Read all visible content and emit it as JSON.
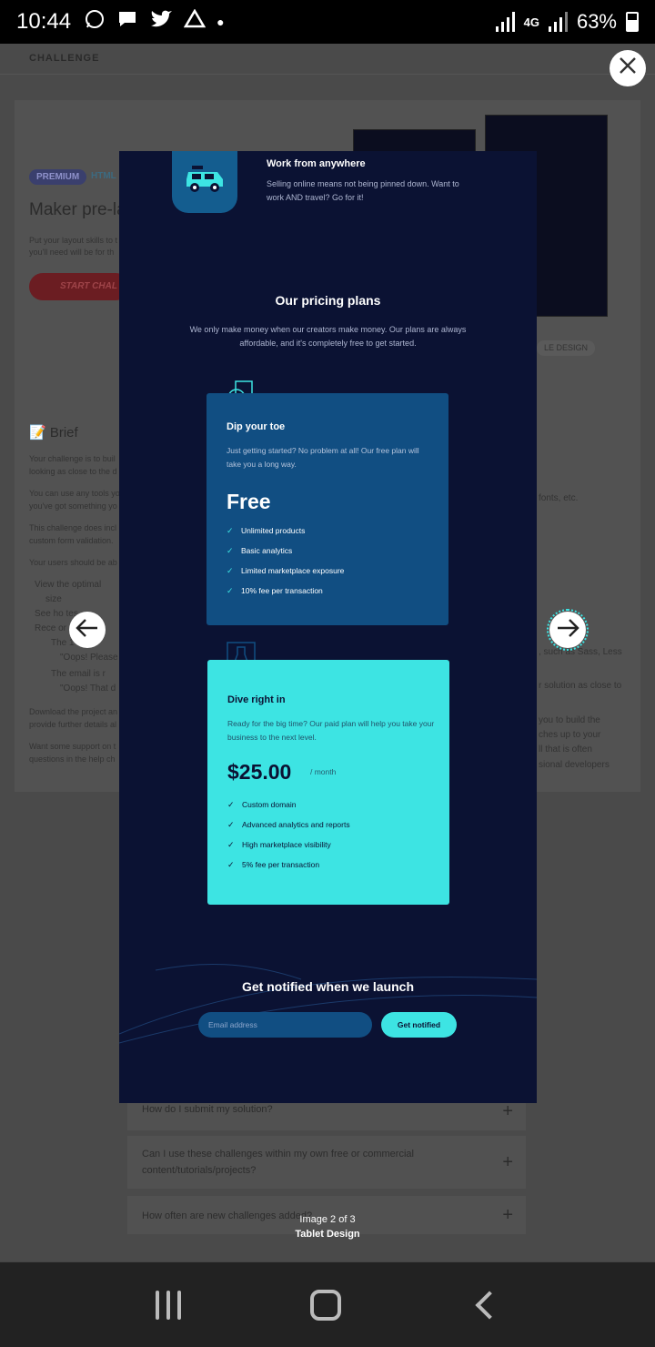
{
  "status_bar": {
    "time": "10:44",
    "network": "4G",
    "battery": "63%",
    "icons": [
      "whatsapp-icon",
      "message-icon",
      "twitter-icon",
      "drive-icon",
      "dot-icon"
    ]
  },
  "background_page": {
    "header": "CHALLENGE",
    "badge_premium": "PREMIUM",
    "badge_html": "HTML",
    "title": "Maker pre-la",
    "intro_line1": "Put your layout skills to t",
    "intro_line2": "you'll need will be for th",
    "start_button": "START CHAL",
    "preview_tag": "LE DESIGN",
    "brief_title": "📝 Brief",
    "brief_lines": [
      "Your challenge is to buil",
      "looking as close to the d",
      "You can use any tools yo",
      "you've got something yo",
      "This challenge does incl",
      "custom form validation.",
      "Your users should be ab"
    ],
    "bullets": [
      "View the optimal",
      "size",
      "See ho    tes",
      "Rece      or"
    ],
    "sub_bullets": [
      "The      1",
      "\"Oops! Please",
      "The email is r",
      "\"Oops! That d"
    ],
    "footer_lines": [
      "Download the project an",
      "provide further details al",
      "Want some support on t",
      "questions in the help ch"
    ],
    "right_fragments": [
      "fonts, etc.",
      ", such as Sass, Less",
      "r solution as close to",
      "you to build the",
      "ches up to your",
      "ll that is often",
      "sional developers"
    ],
    "faq": [
      "How do I submit my solution?",
      "Can I use these challenges within my own free or commercial content/tutorials/projects?",
      "How often are new challenges added?"
    ]
  },
  "modal": {
    "work_title": "Work from anywhere",
    "work_desc": "Selling online means not being pinned down. Want to work AND travel? Go for it!",
    "pricing_title": "Our pricing plans",
    "pricing_desc": "We only make money when our creators make money. Our plans are always affordable, and it's completely free to get started.",
    "plans": [
      {
        "name": "Dip your toe",
        "desc": "Just getting started? No problem at all! Our free plan will take you a long way.",
        "price": "Free",
        "per": "",
        "features": [
          "Unlimited products",
          "Basic analytics",
          "Limited marketplace exposure",
          "10% fee per transaction"
        ]
      },
      {
        "name": "Dive right in",
        "desc": "Ready for the big time? Our paid plan will help you take your business to the next level.",
        "price": "$25.00",
        "per": "/ month",
        "features": [
          "Custom domain",
          "Advanced analytics and reports",
          "High marketplace visibility",
          "5% fee per transaction"
        ]
      }
    ],
    "notify_title": "Get notified when we launch",
    "email_placeholder": "Email address",
    "notify_button": "Get notified"
  },
  "gallery": {
    "counter": "Image 2 of 3",
    "caption": "Tablet Design"
  },
  "colors": {
    "modal_bg": "#0b1233",
    "free_card": "#114e82",
    "paid_card": "#3de4e3",
    "accent": "#3de4e3"
  }
}
